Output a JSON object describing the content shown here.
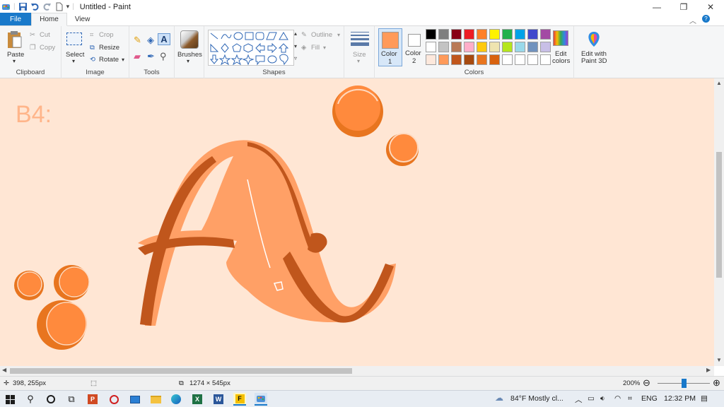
{
  "window": {
    "title": "Untitled - Paint",
    "minimize_icon": "minimize-icon",
    "maximize_icon": "restore-icon",
    "close_icon": "close-icon"
  },
  "tabs": [
    {
      "label": "File"
    },
    {
      "label": "Home"
    },
    {
      "label": "View"
    }
  ],
  "ribbon": {
    "clipboard": {
      "paste": "Paste",
      "cut": "Cut",
      "copy": "Copy",
      "label": "Clipboard"
    },
    "image": {
      "select": "Select",
      "crop": "Crop",
      "resize": "Resize",
      "rotate": "Rotate",
      "label": "Image"
    },
    "tools": {
      "label": "Tools"
    },
    "brushes": {
      "label": "Brushes"
    },
    "shapes": {
      "outline": "Outline",
      "fill": "Fill",
      "label": "Shapes"
    },
    "size": {
      "label": "Size"
    },
    "colors": {
      "color1": "Color\n1",
      "color1_a": "Color",
      "color1_b": "1",
      "color2_a": "Color",
      "color2_b": "2",
      "edit": "Edit",
      "edit2": "colors",
      "label": "Colors",
      "color1_value": "#ff9a5a",
      "color2_value": "#ffffff",
      "palette": [
        "#000000",
        "#7f7f7f",
        "#880015",
        "#ed1c24",
        "#ff7f27",
        "#fff200",
        "#22b14c",
        "#00a2e8",
        "#3f48cc",
        "#a349a4",
        "#ffffff",
        "#c3c3c3",
        "#b97a57",
        "#ffaec9",
        "#ffc90e",
        "#efe4b0",
        "#b5e61d",
        "#99d9ea",
        "#7092be",
        "#c8bfe7",
        "#fde8dc",
        "#ff9a5a",
        "#c0561c",
        "#a64a10",
        "#e8751f",
        "#d8620f",
        "#ffffff",
        "#ffffff",
        "#ffffff",
        "#ffffff"
      ]
    },
    "paint3d": {
      "line1": "Edit with",
      "line2": "Paint 3D"
    }
  },
  "canvas": {
    "text": "B4:",
    "background": "#ffe6d4"
  },
  "statusbar": {
    "cursor_pos": "398, 255px",
    "image_size": "1274 × 545px",
    "zoom": "200%"
  },
  "taskbar": {
    "weather": "84°F  Mostly cl...",
    "lang": "ENG",
    "time": "12:32 PM"
  }
}
